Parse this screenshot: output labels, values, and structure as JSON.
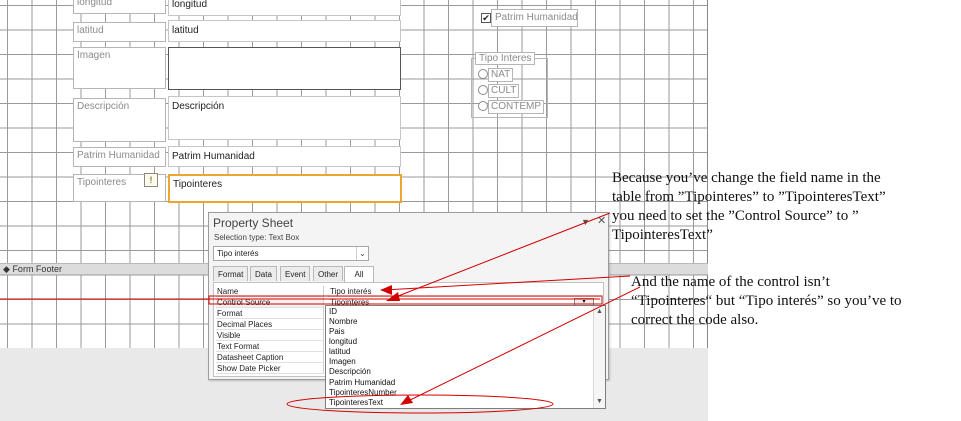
{
  "form": {
    "fields": [
      {
        "label": "longitud",
        "value": "longitud"
      },
      {
        "label": "latitud",
        "value": "latitud"
      },
      {
        "label": "Imagen",
        "value": ""
      },
      {
        "label": "Descripción",
        "value": "Descripción"
      },
      {
        "label": "Patrim Humanidad",
        "value": "Patrim Humanidad"
      },
      {
        "label": "Tipointeres",
        "value": "Tipointeres"
      }
    ],
    "checkbox_label": "Patrim Humanidad",
    "option_group": {
      "caption": "Tipo Interes",
      "options": [
        "NAT",
        "CULT",
        "CONTEMP"
      ]
    },
    "warning_icon": "warning-diamond-icon",
    "footer_section": "Form Footer",
    "footer_icon": "section-marker-icon"
  },
  "property_sheet": {
    "title": "Property Sheet",
    "selection_type": "Selection type:  Text Box",
    "selected_control": "Tipo interés",
    "tabs": [
      "Format",
      "Data",
      "Event",
      "Other",
      "All"
    ],
    "active_tab": "All",
    "rows": [
      {
        "name": "Name",
        "value": "Tipo interés"
      },
      {
        "name": "Control Source",
        "value": "Tipointeres"
      },
      {
        "name": "Format",
        "value": ""
      },
      {
        "name": "Decimal Places",
        "value": ""
      },
      {
        "name": "Visible",
        "value": ""
      },
      {
        "name": "Text Format",
        "value": ""
      },
      {
        "name": "Datasheet Caption",
        "value": ""
      },
      {
        "name": "Show Date Picker",
        "value": ""
      }
    ],
    "dropdown_items": [
      "ID",
      "Nombre",
      "Pais",
      "longitud",
      "latitud",
      "Imagen",
      "Descripción",
      "Patrim Humanidad",
      "TipointeresNumber",
      "TipointeresText"
    ]
  },
  "annotations": {
    "note1": [
      "Because you’ve change the field name in the",
      "table from ”Tipointeres” to ”TipointeresText”",
      "you need to set the ”Control Source” to ”",
      "TipointeresText”"
    ],
    "note2": [
      "And the name of the control isn’t",
      "“Tipointeres“ but “Tipo interés” so you’ve to",
      "correct the code also."
    ]
  },
  "colors": {
    "selection_border": "#f0a430",
    "annotation_red": "#d40000"
  }
}
